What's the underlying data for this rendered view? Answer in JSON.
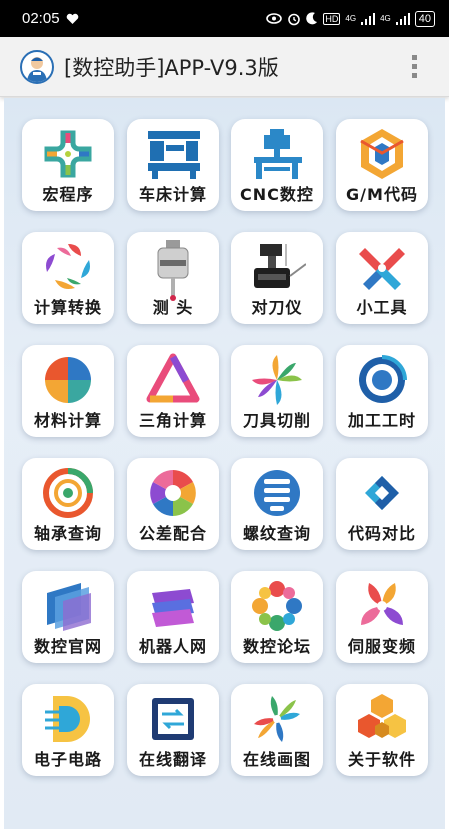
{
  "status_bar": {
    "time": "02:05",
    "icons": [
      "heart-icon",
      "eye-icon",
      "alarm-icon",
      "moon-icon",
      "hd-icon",
      "signal-icon",
      "signal-icon",
      "battery-icon"
    ],
    "hd_label": "HD",
    "net_label_1": "4G",
    "net_label_2": "4G",
    "battery_level": "40"
  },
  "app_bar": {
    "title": "[数控助手]APP-V9.3版",
    "logo_icon": "mascot-logo-icon",
    "menu_icon": "overflow-menu-icon"
  },
  "grid": [
    {
      "label": "宏程序",
      "icon": "macro-program-icon"
    },
    {
      "label": "车床计算",
      "icon": "lathe-icon"
    },
    {
      "label": "CNC数控",
      "icon": "cnc-machine-icon"
    },
    {
      "label": "G/M代码",
      "icon": "gm-code-icon"
    },
    {
      "label": "计算转换",
      "icon": "conversion-icon"
    },
    {
      "label": "测 头",
      "icon": "probe-icon"
    },
    {
      "label": "对刀仪",
      "icon": "tool-setter-icon"
    },
    {
      "label": "小工具",
      "icon": "tools-icon"
    },
    {
      "label": "材料计算",
      "icon": "material-icon"
    },
    {
      "label": "三角计算",
      "icon": "triangle-icon"
    },
    {
      "label": "刀具切削",
      "icon": "cutting-icon"
    },
    {
      "label": "加工工时",
      "icon": "machining-time-icon"
    },
    {
      "label": "轴承查询",
      "icon": "bearing-icon"
    },
    {
      "label": "公差配合",
      "icon": "tolerance-icon"
    },
    {
      "label": "螺纹查询",
      "icon": "thread-icon"
    },
    {
      "label": "代码对比",
      "icon": "code-compare-icon"
    },
    {
      "label": "数控官网",
      "icon": "official-site-icon"
    },
    {
      "label": "机器人网",
      "icon": "robot-net-icon"
    },
    {
      "label": "数控论坛",
      "icon": "forum-icon"
    },
    {
      "label": "伺服变频",
      "icon": "servo-icon"
    },
    {
      "label": "电子电路",
      "icon": "circuit-icon"
    },
    {
      "label": "在线翻译",
      "icon": "translate-icon"
    },
    {
      "label": "在线画图",
      "icon": "drawing-icon"
    },
    {
      "label": "关于软件",
      "icon": "about-icon"
    }
  ]
}
